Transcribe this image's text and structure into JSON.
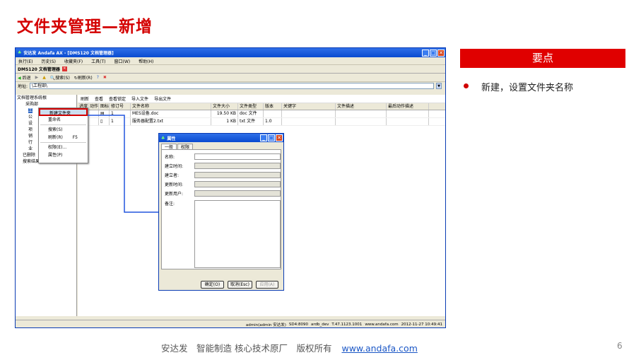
{
  "slide": {
    "title": "文件夹管理—新增",
    "key_points_header": "要点",
    "bullet": "新建，设置文件夹名称",
    "footer_text": "安达发　智能制造 核心技术原厂　版权所有",
    "footer_link": "www.andafa.com",
    "page_number": "6",
    "accent_color": "#d40000"
  },
  "app": {
    "window_title": "安达发 Andafa AX - [DMS120 文档管理器]",
    "menu": [
      "执行(E)",
      "历史(S)",
      "收藏夹(F)",
      "工具(T)",
      "窗口(W)",
      "帮助(H)"
    ],
    "doc_tab": "DMS120 文档管理器",
    "nav": {
      "back": "后退",
      "search": "搜索(S)",
      "refresh": "刷新(R)"
    },
    "address_label": "地址:",
    "address_value": "\\工程部\\",
    "tree": [
      "文档管理系统根",
      "采购部",
      "工",
      "公",
      "设",
      "项",
      "销",
      "行",
      "业",
      "已删除",
      "搜索结果"
    ],
    "context_menu": [
      {
        "label": "新建文件夹",
        "accel": ""
      },
      {
        "label": "重命名",
        "accel": ""
      },
      {
        "label": "搜索(S)",
        "accel": ""
      },
      {
        "label": "刷新(R)",
        "accel": "F5"
      },
      {
        "label": "权限(E)...",
        "accel": ""
      },
      {
        "label": "属性(P)",
        "accel": ""
      }
    ],
    "list_toolbar": [
      "刷新",
      "查看",
      "查看锁定",
      "导入文件",
      "导出文件"
    ],
    "columns": [
      "进度",
      "动作",
      "图标",
      "修订号",
      "文件名称",
      "文件大小",
      "文件类型",
      "版本",
      "关键字",
      "文件描述",
      "最后动作描述"
    ],
    "rows": [
      {
        "rev": "1",
        "name": "MES设备.doc",
        "size": "19.50 KB",
        "type": "doc 文件",
        "ver": ""
      },
      {
        "rev": "1",
        "name": "服务器配置2.txt",
        "size": "1 KB",
        "type": "txt 文件",
        "ver": "1.0"
      }
    ],
    "status": [
      "admin(admin 安达发)",
      "SD4:8090",
      "ardb_dev",
      "T.47.1123.1001",
      "www.andafa.com",
      "2012-11-27 10:49:41"
    ]
  },
  "dialog": {
    "title": "属性",
    "tabs": [
      "一般",
      "权限"
    ],
    "fields": [
      "名称:",
      "建立时间:",
      "建立者:",
      "更新时间:",
      "更新用户:",
      "备注:"
    ],
    "ok": "确定(O)",
    "cancel": "取消(Esc)",
    "apply": "应用(A)"
  }
}
